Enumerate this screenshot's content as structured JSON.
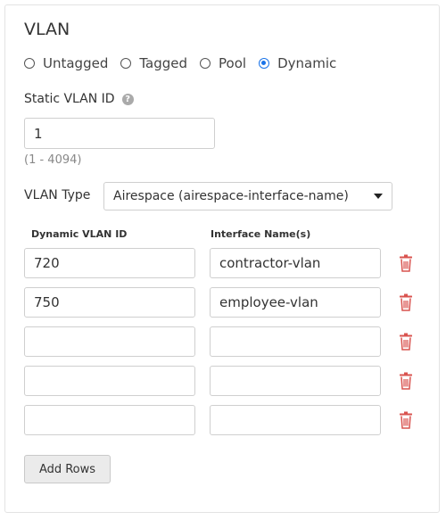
{
  "section_title": "VLAN",
  "vlan_mode": {
    "options": [
      "Untagged",
      "Tagged",
      "Pool",
      "Dynamic"
    ],
    "selected": "Dynamic"
  },
  "static_vlan": {
    "label": "Static VLAN ID",
    "help_icon": "question-circle-icon",
    "value": "1",
    "range_hint": "(1 - 4094)"
  },
  "vlan_type": {
    "label": "VLAN Type",
    "selected": "Airespace (airespace-interface-name)"
  },
  "table": {
    "columns": [
      "Dynamic VLAN ID",
      "Interface Name(s)"
    ],
    "rows": [
      {
        "vlan_id": "720",
        "interface": "contractor-vlan"
      },
      {
        "vlan_id": "750",
        "interface": "employee-vlan"
      },
      {
        "vlan_id": "",
        "interface": ""
      },
      {
        "vlan_id": "",
        "interface": ""
      },
      {
        "vlan_id": "",
        "interface": ""
      }
    ],
    "delete_icon": "trash-icon",
    "delete_color": "#d9534f"
  },
  "add_rows_label": "Add Rows",
  "colors": {
    "accent": "#1a73e8",
    "border": "#cfcfcf"
  }
}
